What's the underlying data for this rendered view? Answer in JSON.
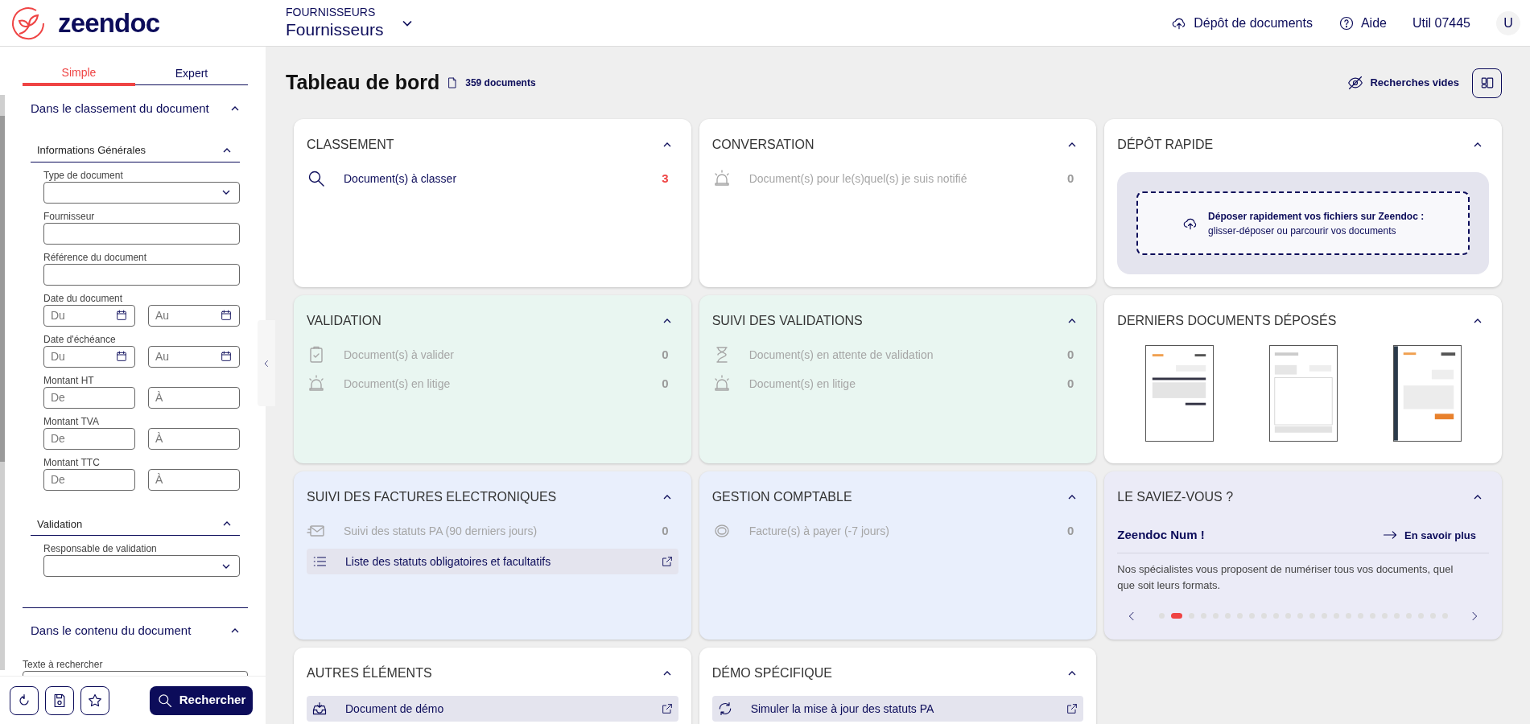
{
  "header": {
    "brand": "zeendoc",
    "context_caption": "FOURNISSEURS",
    "context_value": "Fournisseurs",
    "nav": [
      {
        "kind": "upload",
        "label": "Dépôt de documents"
      },
      {
        "kind": "help",
        "label": "Aide"
      },
      {
        "kind": "user",
        "label": "Util 07445"
      }
    ],
    "avatar": "U"
  },
  "sidebar": {
    "tabs": [
      {
        "label": "Simple",
        "selected": true
      },
      {
        "label": "Expert",
        "selected": false
      }
    ],
    "sections": [
      {
        "title": "Dans le classement du document",
        "expanded": true,
        "groups": [
          {
            "title": "Informations Générales",
            "expanded": true,
            "fields": [
              {
                "label": "Type de document",
                "kind": "select"
              },
              {
                "label": "Fournisseur",
                "kind": "text"
              },
              {
                "label": "Référence du document",
                "kind": "text"
              },
              {
                "label": "Date du document",
                "kind": "date_range",
                "placeholders": [
                  "Du",
                  "Au"
                ]
              },
              {
                "label": "Date d'échéance",
                "kind": "date_range",
                "placeholders": [
                  "Du",
                  "Au"
                ]
              },
              {
                "label": "Montant HT",
                "kind": "range",
                "placeholders": [
                  "De",
                  "À"
                ]
              },
              {
                "label": "Montant TVA",
                "kind": "range",
                "placeholders": [
                  "De",
                  "À"
                ]
              },
              {
                "label": "Montant TTC",
                "kind": "range",
                "placeholders": [
                  "De",
                  "À"
                ]
              }
            ]
          },
          {
            "title": "Validation",
            "expanded": true,
            "fields": [
              {
                "label": "Responsable de validation",
                "kind": "select"
              }
            ]
          }
        ]
      },
      {
        "title": "Dans le contenu du document",
        "expanded": true,
        "fields": [
          {
            "label": "Texte à rechercher",
            "kind": "text"
          }
        ]
      }
    ],
    "search_button": "Rechercher"
  },
  "dashboard": {
    "title": "Tableau de bord",
    "doc_count": "359 documents",
    "empty_searches": "Recherches vides",
    "cards": [
      {
        "title": "CLASSEMENT",
        "kind": "list",
        "expanded": true,
        "color": "#ffffff",
        "items": [
          {
            "kind": "count",
            "label": "Document(s) à classer",
            "count": "3",
            "disabled": false
          }
        ]
      },
      {
        "title": "CONVERSATION",
        "kind": "list",
        "expanded": true,
        "color": "#ffffff",
        "items": [
          {
            "kind": "count",
            "label": "Document(s) pour le(s)quel(s) je suis notifié",
            "count": "0",
            "disabled": true
          }
        ]
      },
      {
        "title": "DÉPÔT RAPIDE",
        "kind": "dropzone",
        "expanded": true,
        "color": "#ffffff",
        "headline": "Déposer rapidement vos fichiers sur Zeendoc :",
        "hint": "glisser-déposer ou parcourir vos documents"
      },
      {
        "title": "VALIDATION",
        "kind": "list",
        "expanded": true,
        "color": "#e9f6f1",
        "items": [
          {
            "kind": "count",
            "label": "Document(s) à valider",
            "count": "0",
            "disabled": true
          },
          {
            "kind": "count",
            "label": "Document(s) en litige",
            "count": "0",
            "disabled": true
          }
        ]
      },
      {
        "title": "SUIVI DES VALIDATIONS",
        "kind": "list",
        "expanded": true,
        "color": "#e9f6f1",
        "items": [
          {
            "kind": "count",
            "label": "Document(s) en attente de validation",
            "count": "0",
            "disabled": true
          },
          {
            "kind": "count",
            "label": "Document(s) en litige",
            "count": "0",
            "disabled": true
          }
        ]
      },
      {
        "title": "DERNIERS DOCUMENTS DÉPOSÉS",
        "kind": "thumbnails",
        "expanded": true,
        "color": "#ffffff"
      },
      {
        "title": "SUIVI DES FACTURES ELECTRONIQUES",
        "kind": "list",
        "expanded": true,
        "color": "#e9effc",
        "items": [
          {
            "kind": "count",
            "label": "Suivi des statuts PA (90 derniers jours)",
            "count": "0",
            "disabled": true
          },
          {
            "kind": "link",
            "label": "Liste des statuts obligatoires et facultatifs"
          }
        ]
      },
      {
        "title": "GESTION COMPTABLE",
        "kind": "list",
        "expanded": true,
        "color": "#e9effc",
        "items": [
          {
            "kind": "count",
            "label": "Facture(s) à payer (-7 jours)",
            "count": "0",
            "disabled": true
          }
        ]
      },
      {
        "title": "LE SAVIEZ-VOUS ?",
        "kind": "tips",
        "expanded": true,
        "color": "#ebebf7",
        "headline": "Zeendoc Num !",
        "link": "En savoir plus",
        "text": "Nos spécialistes vous proposent de numériser tous vos documents, quel que soit leurs formats.",
        "dots": [
          {
            "selected": false
          },
          {
            "selected": true
          },
          {
            "selected": false
          },
          {
            "selected": false
          },
          {
            "selected": false
          },
          {
            "selected": false
          },
          {
            "selected": false
          },
          {
            "selected": false
          },
          {
            "selected": false
          },
          {
            "selected": false
          },
          {
            "selected": false
          },
          {
            "selected": false
          },
          {
            "selected": false
          },
          {
            "selected": false
          },
          {
            "selected": false
          },
          {
            "selected": false
          },
          {
            "selected": false
          },
          {
            "selected": false
          },
          {
            "selected": false
          },
          {
            "selected": false
          },
          {
            "selected": false
          },
          {
            "selected": false
          },
          {
            "selected": false
          },
          {
            "selected": false
          }
        ]
      },
      {
        "title": "AUTRES ÉLÉMENTS",
        "kind": "list",
        "expanded": true,
        "color": "#ffffff",
        "items": [
          {
            "kind": "link",
            "label": "Document de démo"
          }
        ]
      },
      {
        "title": "DÉMO SPÉCIFIQUE",
        "kind": "list",
        "expanded": true,
        "color": "#ffffff",
        "items": [
          {
            "kind": "link",
            "label": "Simuler la mise à jour des statuts PA"
          }
        ]
      }
    ]
  }
}
